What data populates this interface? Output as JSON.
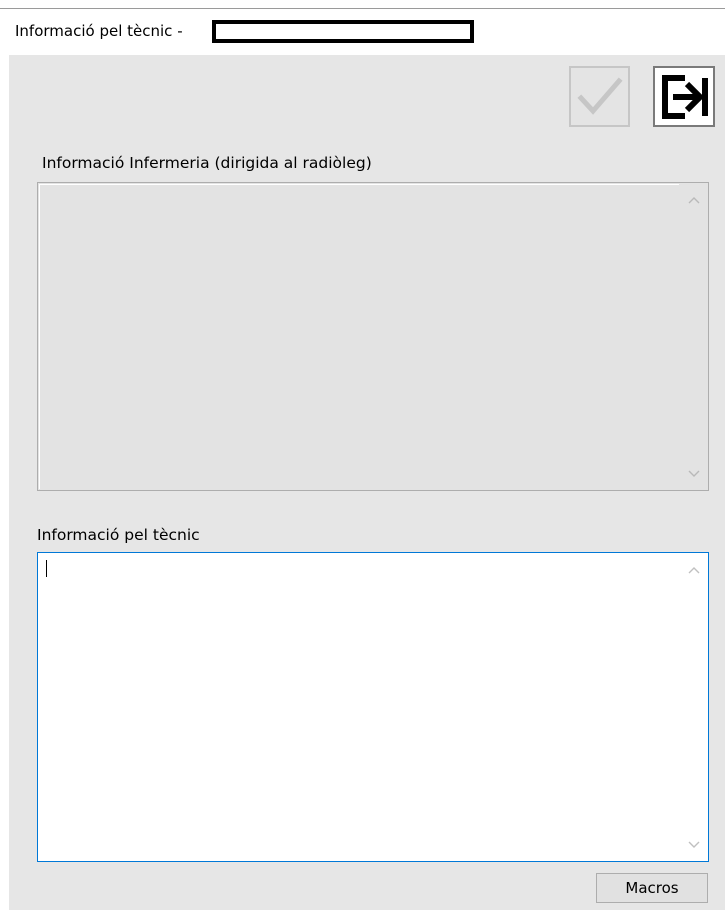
{
  "window": {
    "title": "Informació pel tècnic -"
  },
  "toolbar": {
    "accept_icon": "checkmark-icon",
    "exit_icon": "exit-arrow-icon"
  },
  "nurse_info": {
    "label": "Informació Infermeria (dirigida al radiòleg)",
    "value": ""
  },
  "tech_info": {
    "label": "Informació pel tècnic",
    "value": ""
  },
  "macros": {
    "label": "Macros"
  },
  "colors": {
    "client_background": "#e6e6e6",
    "focus_border": "#0078d7",
    "disabled_icon": "#c6c6c6"
  }
}
